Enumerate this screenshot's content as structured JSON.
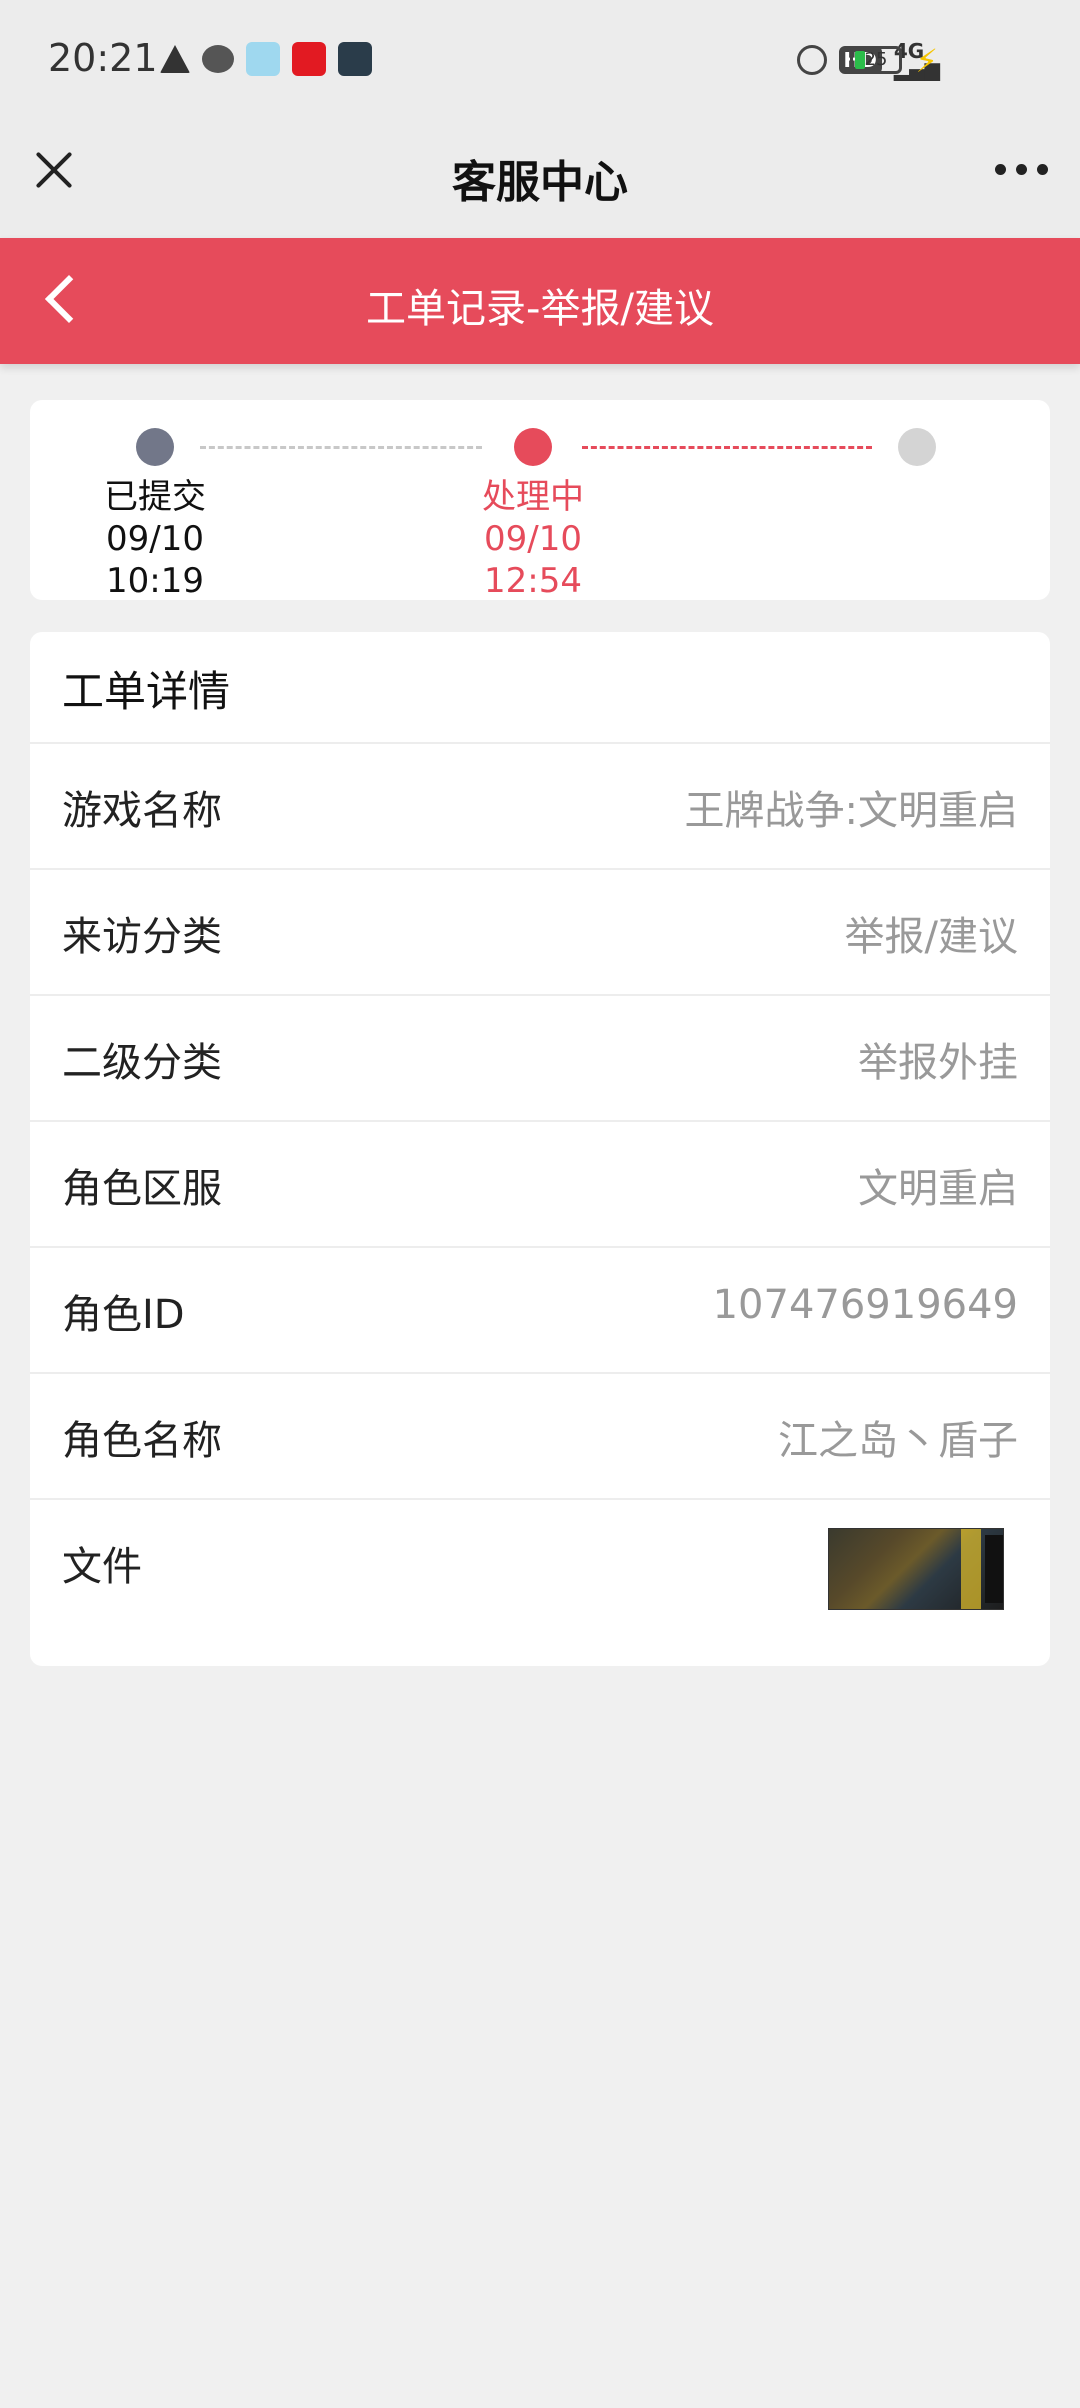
{
  "status_bar": {
    "time": "20:21",
    "battery": "25",
    "icons": [
      "warning-icon",
      "chat-icon",
      "app-icon",
      "mail-app-icon",
      "news-app-icon",
      "alarm-icon",
      "hd-icon",
      "signal-4g-icon",
      "charging-icon"
    ]
  },
  "nav": {
    "title": "客服中心"
  },
  "header": {
    "title": "工单记录-举报/建议"
  },
  "progress": {
    "steps": [
      {
        "label": "已提交",
        "time": "09/10 10:19"
      },
      {
        "label": "处理中",
        "time": "09/10 12:54"
      },
      {
        "label": "",
        "time": ""
      }
    ]
  },
  "details": {
    "title": "工单详情",
    "rows": [
      {
        "label": "游戏名称",
        "value": "王牌战争:文明重启"
      },
      {
        "label": "来访分类",
        "value": "举报/建议"
      },
      {
        "label": "二级分类",
        "value": "举报外挂"
      },
      {
        "label": "角色区服",
        "value": "文明重启"
      },
      {
        "label": "角色ID",
        "value": "107476919649"
      },
      {
        "label": "角色名称",
        "value": "江之岛丶盾子"
      },
      {
        "label": "文件",
        "value": ""
      }
    ]
  },
  "colors": {
    "accent": "#e64b5b",
    "step_done": "#727789",
    "step_pending": "#d4d4d4"
  }
}
